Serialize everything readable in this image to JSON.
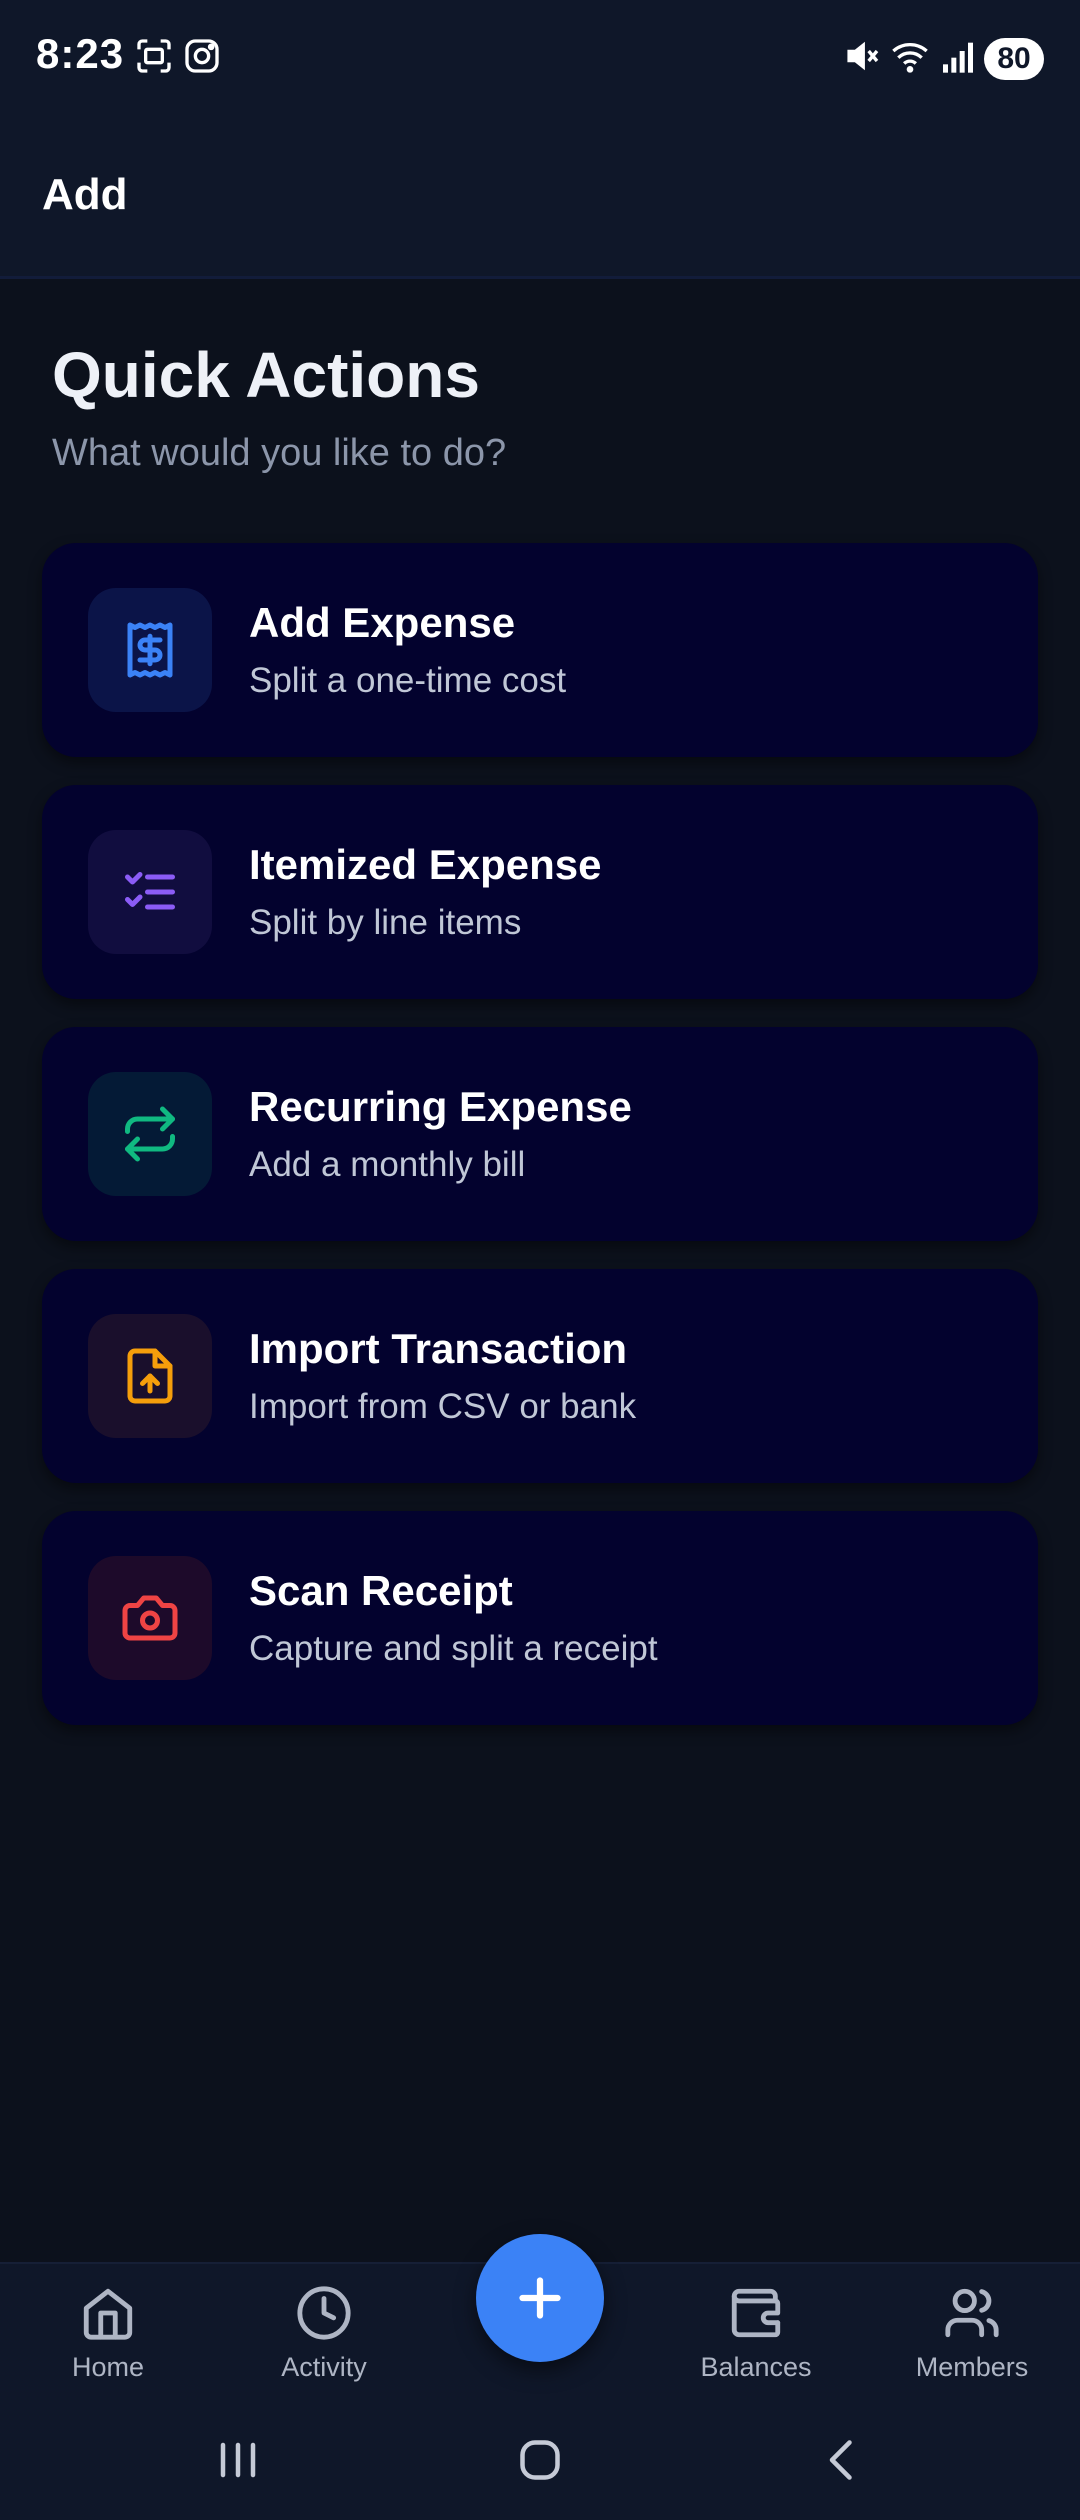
{
  "status_bar": {
    "time": "8:23",
    "battery": "80",
    "icons": [
      "screenshot-icon",
      "instagram-icon",
      "mute-icon",
      "wifi-icon",
      "signal-icon"
    ]
  },
  "app_bar": {
    "title": "Add"
  },
  "header": {
    "title": "Quick Actions",
    "subtitle": "What would you like to do?"
  },
  "actions": [
    {
      "title": "Add Expense",
      "description": "Split a one-time cost",
      "icon": "receipt-dollar-icon",
      "color": "#3b82f6",
      "bg": "#0b1448"
    },
    {
      "title": "Itemized Expense",
      "description": "Split by line items",
      "icon": "checklist-icon",
      "color": "#8b5cf6",
      "bg": "#110d3f"
    },
    {
      "title": "Recurring Expense",
      "description": "Add a monthly bill",
      "icon": "repeat-icon",
      "color": "#10b981",
      "bg": "#041a36"
    },
    {
      "title": "Import Transaction",
      "description": "Import from CSV or bank",
      "icon": "file-upload-icon",
      "color": "#f59e0b",
      "bg": "#1a0f2c"
    },
    {
      "title": "Scan Receipt",
      "description": "Capture and split a receipt",
      "icon": "camera-icon",
      "color": "#ef4444",
      "bg": "#1d0a2a"
    }
  ],
  "bottom_nav": {
    "items": [
      {
        "label": "Home",
        "icon": "home-icon"
      },
      {
        "label": "Activity",
        "icon": "clock-icon"
      },
      {
        "label": "Balances",
        "icon": "wallet-icon"
      },
      {
        "label": "Members",
        "icon": "users-icon"
      }
    ],
    "fab_icon": "plus-icon",
    "fab_color": "#3b82f6"
  },
  "system_nav": {
    "buttons": [
      "recents-icon",
      "home-button-icon",
      "back-icon"
    ]
  }
}
